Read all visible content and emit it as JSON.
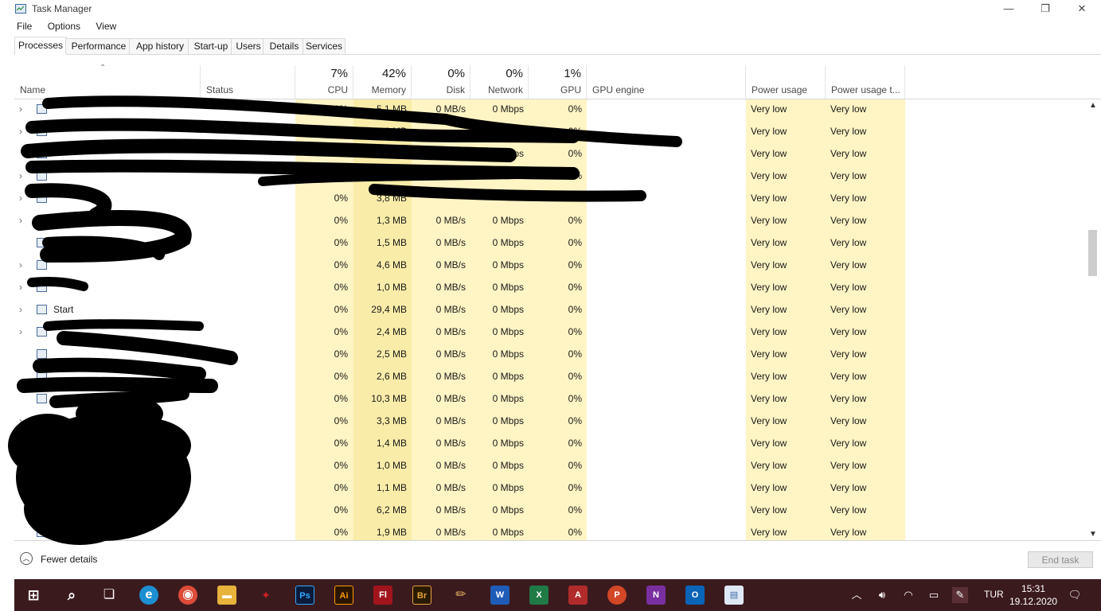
{
  "window": {
    "title": "Task Manager",
    "controls": {
      "minimize": "—",
      "maximize": "❐",
      "close": "✕"
    }
  },
  "menu": [
    "File",
    "Options",
    "View"
  ],
  "tabs": [
    "Processes",
    "Performance",
    "App history",
    "Start-up",
    "Users",
    "Details",
    "Services"
  ],
  "active_tab": "Processes",
  "columns": {
    "name": {
      "label": "Name"
    },
    "status": {
      "label": "Status"
    },
    "cpu": {
      "label": "CPU",
      "total": "7%"
    },
    "memory": {
      "label": "Memory",
      "total": "42%"
    },
    "disk": {
      "label": "Disk",
      "total": "0%"
    },
    "network": {
      "label": "Network",
      "total": "0%"
    },
    "gpu": {
      "label": "GPU",
      "total": "1%"
    },
    "gpu_engine": {
      "label": "GPU engine"
    },
    "power": {
      "label": "Power usage"
    },
    "power_trend": {
      "label": "Power usage t..."
    }
  },
  "rows": [
    {
      "name": "",
      "expandable": true,
      "cpu": "0%",
      "memory": "5,1 MB",
      "disk": "0 MB/s",
      "network": "0 Mbps",
      "gpu": "0%",
      "power": "Very low",
      "power_trend": "Very low"
    },
    {
      "name": "",
      "expandable": true,
      "cpu": "0%",
      "memory": "5,6 MB",
      "disk": "",
      "network": "",
      "gpu": "0%",
      "power": "Very low",
      "power_trend": "Very low"
    },
    {
      "name": "",
      "expandable": false,
      "cpu": "0%",
      "memory": "",
      "disk": "",
      "network": "0 Mbps",
      "gpu": "0%",
      "power": "Very low",
      "power_trend": "Very low"
    },
    {
      "name": "",
      "expandable": true,
      "cpu": "0%",
      "memory": "",
      "disk": "",
      "network": "",
      "gpu": "0%",
      "power": "Very low",
      "power_trend": "Very low"
    },
    {
      "name": "",
      "expandable": true,
      "cpu": "0%",
      "memory": "3,8 MB",
      "disk": "",
      "network": "",
      "gpu": "",
      "power": "Very low",
      "power_trend": "Very low"
    },
    {
      "name": "",
      "expandable": true,
      "cpu": "0%",
      "memory": "1,3 MB",
      "disk": "0 MB/s",
      "network": "0 Mbps",
      "gpu": "0%",
      "power": "Very low",
      "power_trend": "Very low"
    },
    {
      "name": "",
      "expandable": false,
      "cpu": "0%",
      "memory": "1,5 MB",
      "disk": "0 MB/s",
      "network": "0 Mbps",
      "gpu": "0%",
      "power": "Very low",
      "power_trend": "Very low"
    },
    {
      "name": "",
      "expandable": true,
      "cpu": "0%",
      "memory": "4,6 MB",
      "disk": "0 MB/s",
      "network": "0 Mbps",
      "gpu": "0%",
      "power": "Very low",
      "power_trend": "Very low"
    },
    {
      "name": "",
      "expandable": true,
      "cpu": "0%",
      "memory": "1,0 MB",
      "disk": "0 MB/s",
      "network": "0 Mbps",
      "gpu": "0%",
      "power": "Very low",
      "power_trend": "Very low"
    },
    {
      "name": "Start",
      "expandable": true,
      "cpu": "0%",
      "memory": "29,4 MB",
      "disk": "0 MB/s",
      "network": "0 Mbps",
      "gpu": "0%",
      "power": "Very low",
      "power_trend": "Very low"
    },
    {
      "name": "",
      "expandable": true,
      "cpu": "0%",
      "memory": "2,4 MB",
      "disk": "0 MB/s",
      "network": "0 Mbps",
      "gpu": "0%",
      "power": "Very low",
      "power_trend": "Very low"
    },
    {
      "name": "",
      "expandable": false,
      "cpu": "0%",
      "memory": "2,5 MB",
      "disk": "0 MB/s",
      "network": "0 Mbps",
      "gpu": "0%",
      "power": "Very low",
      "power_trend": "Very low"
    },
    {
      "name": "",
      "expandable": false,
      "cpu": "0%",
      "memory": "2,6 MB",
      "disk": "0 MB/s",
      "network": "0 Mbps",
      "gpu": "0%",
      "power": "Very low",
      "power_trend": "Very low"
    },
    {
      "name": "",
      "expandable": false,
      "cpu": "0%",
      "memory": "10,3 MB",
      "disk": "0 MB/s",
      "network": "0 Mbps",
      "gpu": "0%",
      "power": "Very low",
      "power_trend": "Very low"
    },
    {
      "name": "",
      "expandable": true,
      "cpu": "0%",
      "memory": "3,3 MB",
      "disk": "0 MB/s",
      "network": "0 Mbps",
      "gpu": "0%",
      "power": "Very low",
      "power_trend": "Very low"
    },
    {
      "name": "",
      "expandable": false,
      "cpu": "0%",
      "memory": "1,4 MB",
      "disk": "0 MB/s",
      "network": "0 Mbps",
      "gpu": "0%",
      "power": "Very low",
      "power_trend": "Very low"
    },
    {
      "name": "",
      "expandable": false,
      "cpu": "0%",
      "memory": "1,0 MB",
      "disk": "0 MB/s",
      "network": "0 Mbps",
      "gpu": "0%",
      "power": "Very low",
      "power_trend": "Very low"
    },
    {
      "name": "",
      "expandable": false,
      "cpu": "0%",
      "memory": "1,1 MB",
      "disk": "0 MB/s",
      "network": "0 Mbps",
      "gpu": "0%",
      "power": "Very low",
      "power_trend": "Very low"
    },
    {
      "name": "",
      "expandable": false,
      "cpu": "0%",
      "memory": "6,2 MB",
      "disk": "0 MB/s",
      "network": "0 Mbps",
      "gpu": "0%",
      "power": "Very low",
      "power_trend": "Very low"
    },
    {
      "name": "",
      "expandable": false,
      "cpu": "0%",
      "memory": "1,9 MB",
      "disk": "0 MB/s",
      "network": "0 Mbps",
      "gpu": "0%",
      "power": "Very low",
      "power_trend": "Very low"
    }
  ],
  "footer": {
    "fewer_details": "Fewer details",
    "end_task": "End task"
  },
  "colors": {
    "highlight_light": "#fff4c4",
    "highlight_medium": "#f9eca8",
    "taskbar_bg": "#3b1a1e"
  },
  "taskbar": {
    "apps": [
      {
        "name": "start-icon",
        "label": ""
      },
      {
        "name": "search-icon",
        "label": ""
      },
      {
        "name": "task-view-icon",
        "label": ""
      },
      {
        "name": "edge-icon",
        "label": ""
      },
      {
        "name": "chrome-icon",
        "label": ""
      },
      {
        "name": "file-explorer-icon",
        "label": ""
      },
      {
        "name": "app-icon",
        "label": ""
      },
      {
        "name": "photoshop-icon",
        "label": "Ps"
      },
      {
        "name": "illustrator-icon",
        "label": "Ai"
      },
      {
        "name": "flash-icon",
        "label": "Fl"
      },
      {
        "name": "bridge-icon",
        "label": "Br"
      },
      {
        "name": "pencil-app-icon",
        "label": ""
      },
      {
        "name": "word-icon",
        "label": "W"
      },
      {
        "name": "excel-icon",
        "label": "X"
      },
      {
        "name": "access-icon",
        "label": "A"
      },
      {
        "name": "powerpoint-icon",
        "label": "P"
      },
      {
        "name": "onenote-icon",
        "label": "N"
      },
      {
        "name": "outlook-icon",
        "label": "O"
      },
      {
        "name": "task-manager-icon",
        "label": ""
      }
    ],
    "tray": {
      "language": "TUR",
      "time": "15:31",
      "date": "19.12.2020"
    }
  }
}
